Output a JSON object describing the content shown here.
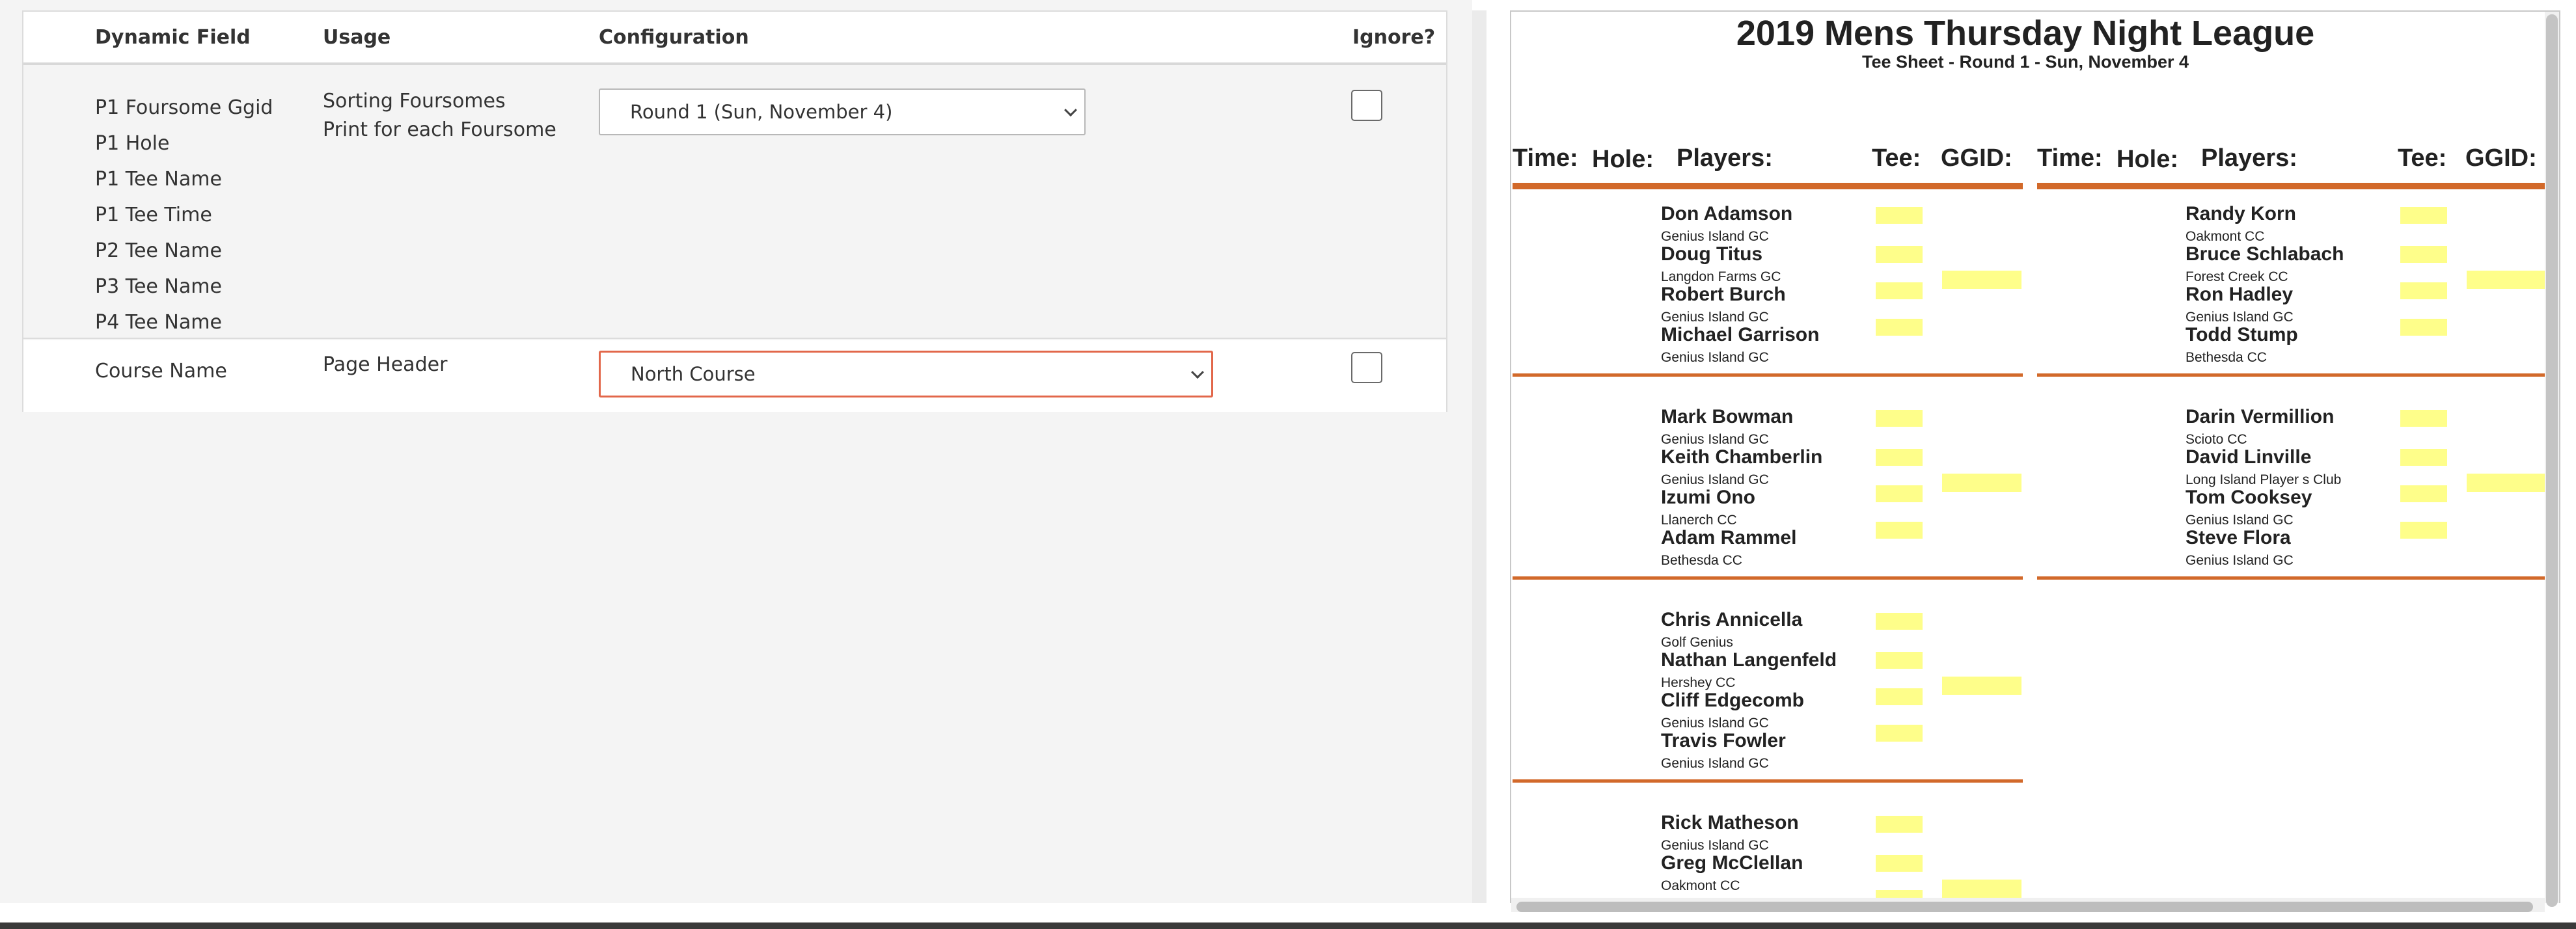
{
  "table": {
    "headers": {
      "dynamic_field": "Dynamic Field",
      "usage": "Usage",
      "configuration": "Configuration",
      "ignore": "Ignore?"
    },
    "rows": [
      {
        "fields": [
          "P1 Foursome Ggid",
          "P1 Hole",
          "P1 Tee Name",
          "P1 Tee Time",
          "P2 Tee Name",
          "P3 Tee Name",
          "P4 Tee Name"
        ],
        "usage": [
          "Sorting Foursomes",
          "Print for each Foursome"
        ],
        "config_value": "Round 1 (Sun, November 4)",
        "ignored": false
      },
      {
        "fields": [
          "Course Name"
        ],
        "usage": [
          "Page Header"
        ],
        "config_value": "North Course",
        "ignored": false
      }
    ]
  },
  "preview": {
    "title": "2019 Mens Thursday Night League",
    "subtitle": "Tee Sheet - Round 1 - Sun, November 4",
    "columns": [
      "Time:",
      "Hole:",
      "Players:",
      "Tee:",
      "GGID:"
    ],
    "left_groups": [
      {
        "players": [
          {
            "name": "Don Adamson",
            "club": "Genius Island GC"
          },
          {
            "name": "Doug Titus",
            "club": "Langdon Farms GC"
          },
          {
            "name": "Robert Burch",
            "club": "Genius Island GC"
          },
          {
            "name": "Michael Garrison",
            "club": "Genius Island GC"
          }
        ]
      },
      {
        "players": [
          {
            "name": "Mark Bowman",
            "club": "Genius Island GC"
          },
          {
            "name": "Keith Chamberlin",
            "club": "Genius Island GC"
          },
          {
            "name": "Izumi Ono",
            "club": "Llanerch CC"
          },
          {
            "name": "Adam Rammel",
            "club": "Bethesda CC"
          }
        ]
      },
      {
        "players": [
          {
            "name": "Chris Annicella",
            "club": "Golf Genius"
          },
          {
            "name": "Nathan Langenfeld",
            "club": "Hershey CC"
          },
          {
            "name": "Cliff Edgecomb",
            "club": "Genius Island GC"
          },
          {
            "name": "Travis Fowler",
            "club": "Genius Island GC"
          }
        ]
      },
      {
        "players": [
          {
            "name": "Rick Matheson",
            "club": "Genius Island GC"
          },
          {
            "name": "Greg McClellan",
            "club": "Oakmont CC"
          }
        ]
      }
    ],
    "right_groups": [
      {
        "players": [
          {
            "name": "Randy Korn",
            "club": "Oakmont CC"
          },
          {
            "name": "Bruce Schlabach",
            "club": "Forest Creek CC"
          },
          {
            "name": "Ron Hadley",
            "club": "Genius Island GC"
          },
          {
            "name": "Todd Stump",
            "club": "Bethesda CC"
          }
        ]
      },
      {
        "players": [
          {
            "name": "Darin Vermillion",
            "club": "Scioto CC"
          },
          {
            "name": "David Linville",
            "club": "Long Island Player s Club"
          },
          {
            "name": "Tom Cooksey",
            "club": "Genius Island GC"
          },
          {
            "name": "Steve Flora",
            "club": "Genius Island GC"
          }
        ]
      }
    ]
  },
  "colors": {
    "accent_orange": "#d2692a",
    "select_focus_border": "#e2674a",
    "highlight_yellow": "#fefe8a"
  }
}
